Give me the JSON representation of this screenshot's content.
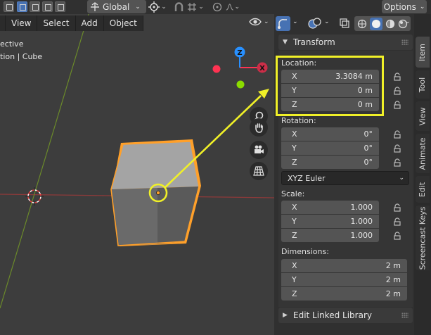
{
  "header": {
    "orientation_label": "Global",
    "options_label": "Options",
    "chevron_glyph": "⌄"
  },
  "viewport": {
    "menu": [
      "View",
      "Select",
      "Add",
      "Object"
    ],
    "info_line1": "ective",
    "info_line2": "tion | Cube",
    "gizmo": {
      "z_label": "Z",
      "x_label": "X"
    },
    "colors": {
      "axis_x": "#ff3352",
      "axis_y": "#8bdc00",
      "axis_z": "#2890ff",
      "selection_outline": "#ffa02a",
      "annotation": "#f0f028"
    }
  },
  "properties": {
    "tabs": [
      "Item",
      "Tool",
      "View",
      "Animate",
      "Edit",
      "Screencast Keys"
    ],
    "transform": {
      "title": "Transform",
      "location": {
        "label": "Location:",
        "x": {
          "axis": "X",
          "value": "3.3084 m"
        },
        "y": {
          "axis": "Y",
          "value": "0 m"
        },
        "z": {
          "axis": "Z",
          "value": "0 m"
        }
      },
      "rotation": {
        "label": "Rotation:",
        "x": {
          "axis": "X",
          "value": "0°"
        },
        "y": {
          "axis": "Y",
          "value": "0°"
        },
        "z": {
          "axis": "Z",
          "value": "0°"
        },
        "mode": "XYZ Euler"
      },
      "scale": {
        "label": "Scale:",
        "x": {
          "axis": "X",
          "value": "1.000"
        },
        "y": {
          "axis": "Y",
          "value": "1.000"
        },
        "z": {
          "axis": "Z",
          "value": "1.000"
        }
      },
      "dimensions": {
        "label": "Dimensions:",
        "x": {
          "axis": "X",
          "value": "2 m"
        },
        "y": {
          "axis": "Y",
          "value": "2 m"
        },
        "z": {
          "axis": "Z",
          "value": "2 m"
        }
      }
    },
    "linked_library": {
      "title": "Edit Linked Library"
    }
  }
}
